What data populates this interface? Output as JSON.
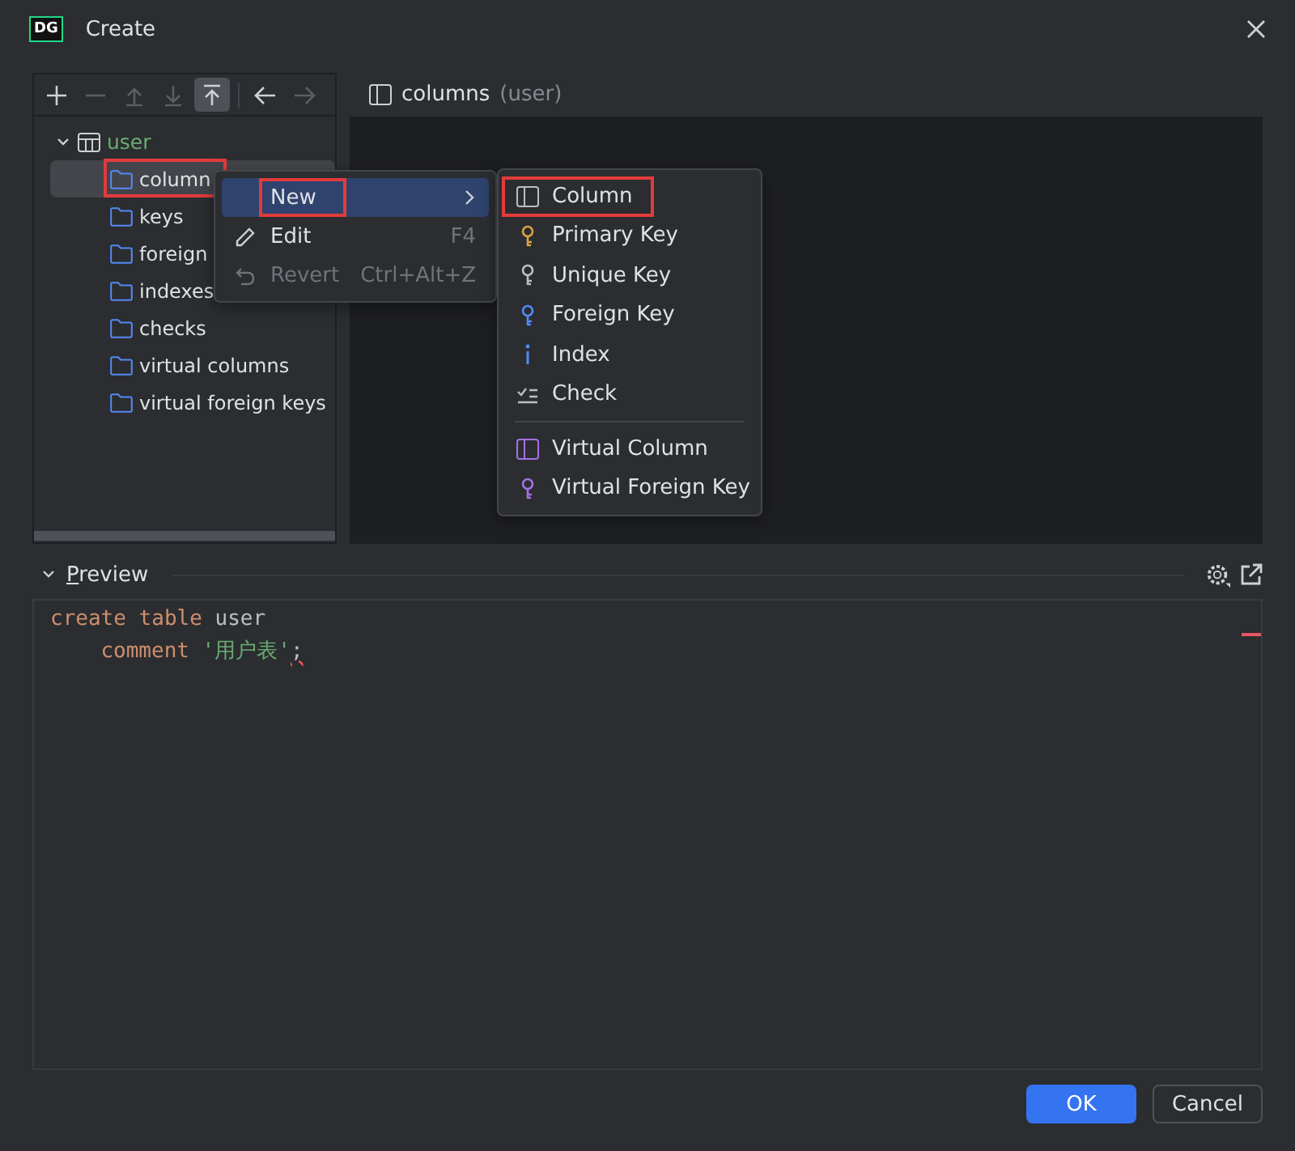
{
  "window": {
    "app_icon": "DG",
    "title": "Create"
  },
  "toolbar": [
    {
      "kind": "add",
      "disabled": false,
      "selected": false
    },
    {
      "kind": "remove",
      "disabled": true,
      "selected": false
    },
    {
      "kind": "up",
      "disabled": true,
      "selected": false
    },
    {
      "kind": "down",
      "disabled": true,
      "selected": false
    },
    {
      "kind": "top",
      "disabled": false,
      "selected": true
    },
    {
      "kind": "separator"
    },
    {
      "kind": "back",
      "disabled": false,
      "selected": false
    },
    {
      "kind": "forward",
      "disabled": true,
      "selected": false
    }
  ],
  "tree": {
    "label": "user",
    "expanded": true,
    "children": [
      {
        "label": "column",
        "selected": true,
        "annotated": true
      },
      {
        "label": "keys",
        "selected": false,
        "annotated": false
      },
      {
        "label": "foreign",
        "selected": false,
        "annotated": false
      },
      {
        "label": "indexes",
        "selected": false,
        "annotated": false
      },
      {
        "label": "checks",
        "selected": false,
        "annotated": false
      },
      {
        "label": "virtual columns",
        "selected": false,
        "annotated": false
      },
      {
        "label": "virtual foreign keys",
        "selected": false,
        "annotated": false
      }
    ]
  },
  "detail": {
    "title": "columns",
    "subtitle": "(user)"
  },
  "context_menu": [
    {
      "label": "New",
      "kind": "submenu",
      "selected": true,
      "disabled": false,
      "annotated": true
    },
    {
      "label": "Edit",
      "shortcut": "F4",
      "kind": "edit",
      "selected": false,
      "disabled": false,
      "annotated": false
    },
    {
      "label": "Revert",
      "shortcut": "Ctrl+Alt+Z",
      "kind": "revert",
      "selected": false,
      "disabled": true,
      "annotated": false
    }
  ],
  "submenu": [
    {
      "kind": "column",
      "label": "Column",
      "color": "#bcbec4",
      "annotated": true
    },
    {
      "kind": "key",
      "label": "Primary Key",
      "color": "#d9a343",
      "annotated": false
    },
    {
      "kind": "key",
      "label": "Unique Key",
      "color": "#bcbec4",
      "annotated": false
    },
    {
      "kind": "key",
      "label": "Foreign Key",
      "color": "#548af7",
      "annotated": false
    },
    {
      "kind": "index",
      "label": "Index",
      "color": "#548af7",
      "annotated": false
    },
    {
      "kind": "check",
      "label": "Check",
      "color": "#bcbec4",
      "annotated": false
    },
    {
      "kind": "separator"
    },
    {
      "kind": "column",
      "label": "Virtual Column",
      "color": "#a571e6",
      "annotated": false
    },
    {
      "kind": "key",
      "label": "Virtual Foreign Key",
      "color": "#a571e6",
      "annotated": false
    }
  ],
  "preview": {
    "label": "Preview",
    "expanded": true,
    "error_marker": true,
    "code": [
      {
        "tokens": [
          {
            "kind": "keyword",
            "text": "create table"
          },
          {
            "kind": "plain",
            "text": " user"
          }
        ],
        "children": [
          {
            "tokens": [
              {
                "kind": "keyword",
                "text": "comment"
              },
              {
                "kind": "string",
                "text": " '用户表'"
              },
              {
                "kind": "error",
                "text": ";"
              }
            ]
          }
        ]
      }
    ]
  },
  "buttons": [
    {
      "label": "OK",
      "kind": "primary"
    },
    {
      "label": "Cancel",
      "kind": "secondary"
    }
  ]
}
